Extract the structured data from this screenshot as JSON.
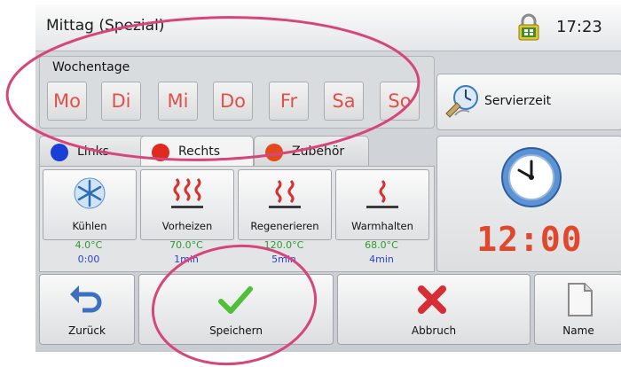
{
  "header": {
    "title": "Mittag (Spezial)",
    "time": "17:23"
  },
  "weekdays": {
    "label": "Wochentage",
    "days": [
      "Mo",
      "Di",
      "Mi",
      "Do",
      "Fr",
      "Sa",
      "So"
    ],
    "color": "#e0514a"
  },
  "serving": {
    "label": "Servierzeit",
    "icon": "serving-time-icon"
  },
  "tabs": [
    {
      "label": "Links",
      "dot_color": "#1a3fd6"
    },
    {
      "label": "Rechts",
      "dot_color": "#e12a1f"
    },
    {
      "label": "Zubehör",
      "dot_color": "#e24a1c"
    }
  ],
  "modes": [
    {
      "label": "Kühlen",
      "temp": "4.0°C",
      "time": "0:00",
      "icon": "snowflake-icon"
    },
    {
      "label": "Vorheizen",
      "temp": "70.0°C",
      "time": "1min",
      "icon": "heating-coils-icon"
    },
    {
      "label": "Regenerieren",
      "temp": "120.0°C",
      "time": "5min",
      "icon": "regenerate-coils-icon"
    },
    {
      "label": "Warmhalten",
      "temp": "68.0°C",
      "time": "4min",
      "icon": "warm-hold-icon"
    }
  ],
  "serving_time": {
    "value": "12:00",
    "color": "#e2472c"
  },
  "actions": {
    "back": "Zurück",
    "save": "Speichern",
    "cancel": "Abbruch",
    "name": "Name"
  },
  "colors": {
    "temp": "#2e9a2e",
    "time": "#2b43c9",
    "annotation": "#d6467a"
  }
}
